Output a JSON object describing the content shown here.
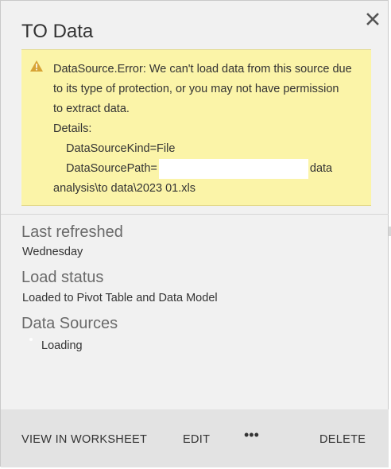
{
  "pane": {
    "title": "TO Data",
    "close_icon": "close-icon"
  },
  "error": {
    "icon": "warning-icon",
    "line1": "DataSource.Error: We can't load data from this source due",
    "line2": "to its type of protection, or you may not have permission",
    "line3": "to extract data.",
    "details_label": "Details:",
    "kind": "DataSourceKind=File",
    "path_label": "DataSourcePath=",
    "path_tail": "data",
    "path_end": "analysis\\to data\\2023 01.xls",
    "background_color": "#fbf4a8"
  },
  "sections": {
    "last_refreshed_title": "Last refreshed",
    "last_refreshed_value": "Wednesday",
    "load_status_title": "Load status",
    "load_status_value": "Loaded to Pivot Table and Data Model",
    "data_sources_title": "Data Sources",
    "data_sources_value": "Loading"
  },
  "footer": {
    "view_label": "VIEW IN WORKSHEET",
    "edit_label": "EDIT",
    "more_label": "•••",
    "delete_label": "DELETE"
  }
}
